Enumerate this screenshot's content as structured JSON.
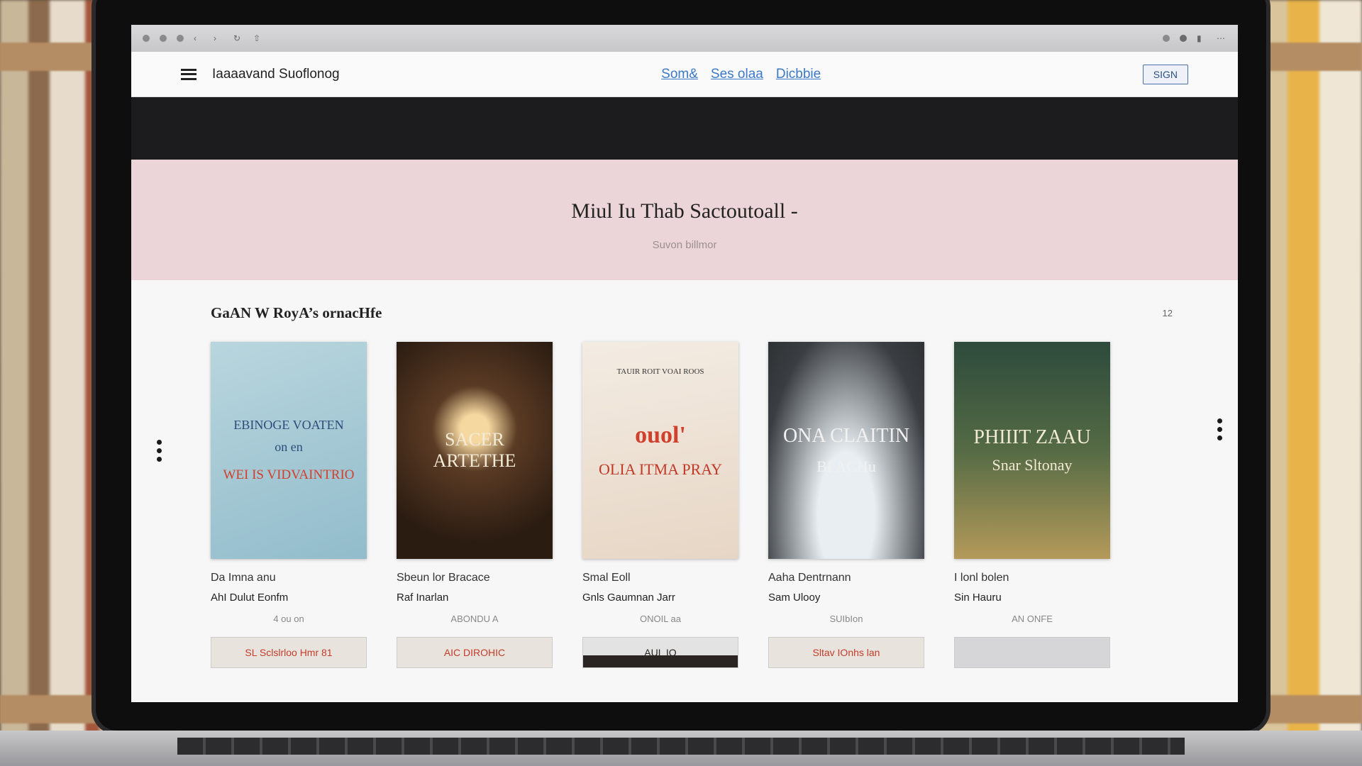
{
  "browser": {
    "toolbar_icons": [
      "back-icon",
      "forward-icon",
      "reload-icon",
      "home-icon",
      "tab-icon",
      "share-icon"
    ],
    "window_icons": [
      "extension-icon",
      "record-icon",
      "lock-icon",
      "menu-icon"
    ]
  },
  "site": {
    "brand": "Iaaaavand Suoflonog",
    "nav": [
      "Som&",
      "Ses olaa",
      "Dicbbie"
    ],
    "signin_label": "SIGN"
  },
  "hero": {
    "title": "Miul Iu Thab Sactoutoall -",
    "subtitle": "Suvon billmor"
  },
  "section": {
    "title": "GaAN W RoyA’s ornacHfe",
    "count": "12"
  },
  "books": [
    {
      "cover_top": "EBINOGE VOATEN",
      "cover_mid": "on en",
      "cover_bottom": "WEI IS VIDVAINTRIO",
      "title": "Da Imna anu",
      "author": "AhI Dulut Eonfm",
      "price": "4 ou on"
    },
    {
      "cover_top": "SACER ARTETHE",
      "title": "Sbeun lor Bracace",
      "author": "Raf Inarlan",
      "price": "ABONDU A"
    },
    {
      "cover_top": "TAUIR ROIT VOAI ROOS",
      "cover_mid": "ouol'",
      "cover_bottom": "OLIA ITMA PRAY",
      "title": "Smal Eoll",
      "author": "Gnls Gaumnan Jarr",
      "price": "ONOIL aa"
    },
    {
      "cover_top": "ONA CLAITIN",
      "cover_bottom": "BI ACHu",
      "title": "Aaha Dentrnann",
      "author": "Sam Ulooy",
      "price": "SUIbIon"
    },
    {
      "cover_top": "PHIIIT ZAAU",
      "cover_bottom": "Snar Sltonay",
      "title": "I lonl bolen",
      "author": "Sin Hauru",
      "price": "AN ONFE"
    }
  ],
  "next_row": [
    "SL Sclslrloo Hmr 81",
    "AIC DIROHIC",
    "AUL IO",
    "Sltav IOnhs lan",
    ""
  ]
}
